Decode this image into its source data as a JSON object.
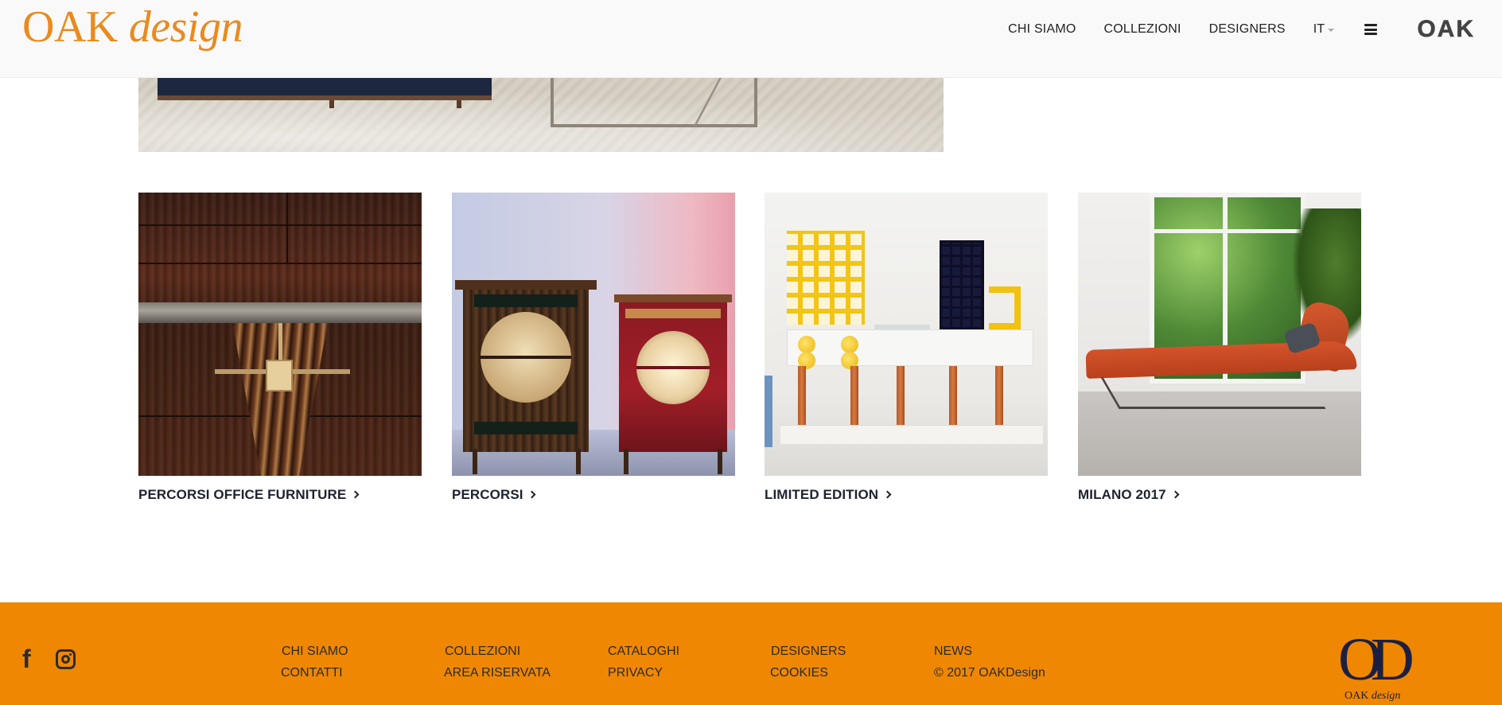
{
  "header": {
    "brand_word1": "OAK",
    "brand_word2": "design",
    "brand_color": "#ea8a1e",
    "nav": [
      {
        "label": "CHI SIAMO"
      },
      {
        "label": "COLLEZIONI"
      },
      {
        "label": "DESIGNERS"
      }
    ],
    "language": "IT",
    "menu_icon": "hamburger-icon",
    "right_logo": "OAK"
  },
  "cards": [
    {
      "title": "PERCORSI OFFICE FURNITURE"
    },
    {
      "title": "PERCORSI"
    },
    {
      "title": "LIMITED EDITION"
    },
    {
      "title": "MILANO 2017"
    }
  ],
  "footer": {
    "background": "#ef8702",
    "social": [
      "facebook-icon",
      "instagram-icon"
    ],
    "columns": [
      {
        "top": "CHI SIAMO",
        "bottom": "CONTATTI"
      },
      {
        "top": "COLLEZIONI",
        "bottom": "AREA RISERVATA"
      },
      {
        "top": "CATALOGHI",
        "bottom": "PRIVACY"
      },
      {
        "top": "DESIGNERS",
        "bottom": "COOKIES"
      },
      {
        "top": "NEWS",
        "bottom": "© 2017 OAKDesign"
      }
    ],
    "logo_mark": "OD",
    "logo_sub_word1": "OAK",
    "logo_sub_word2": "design"
  }
}
